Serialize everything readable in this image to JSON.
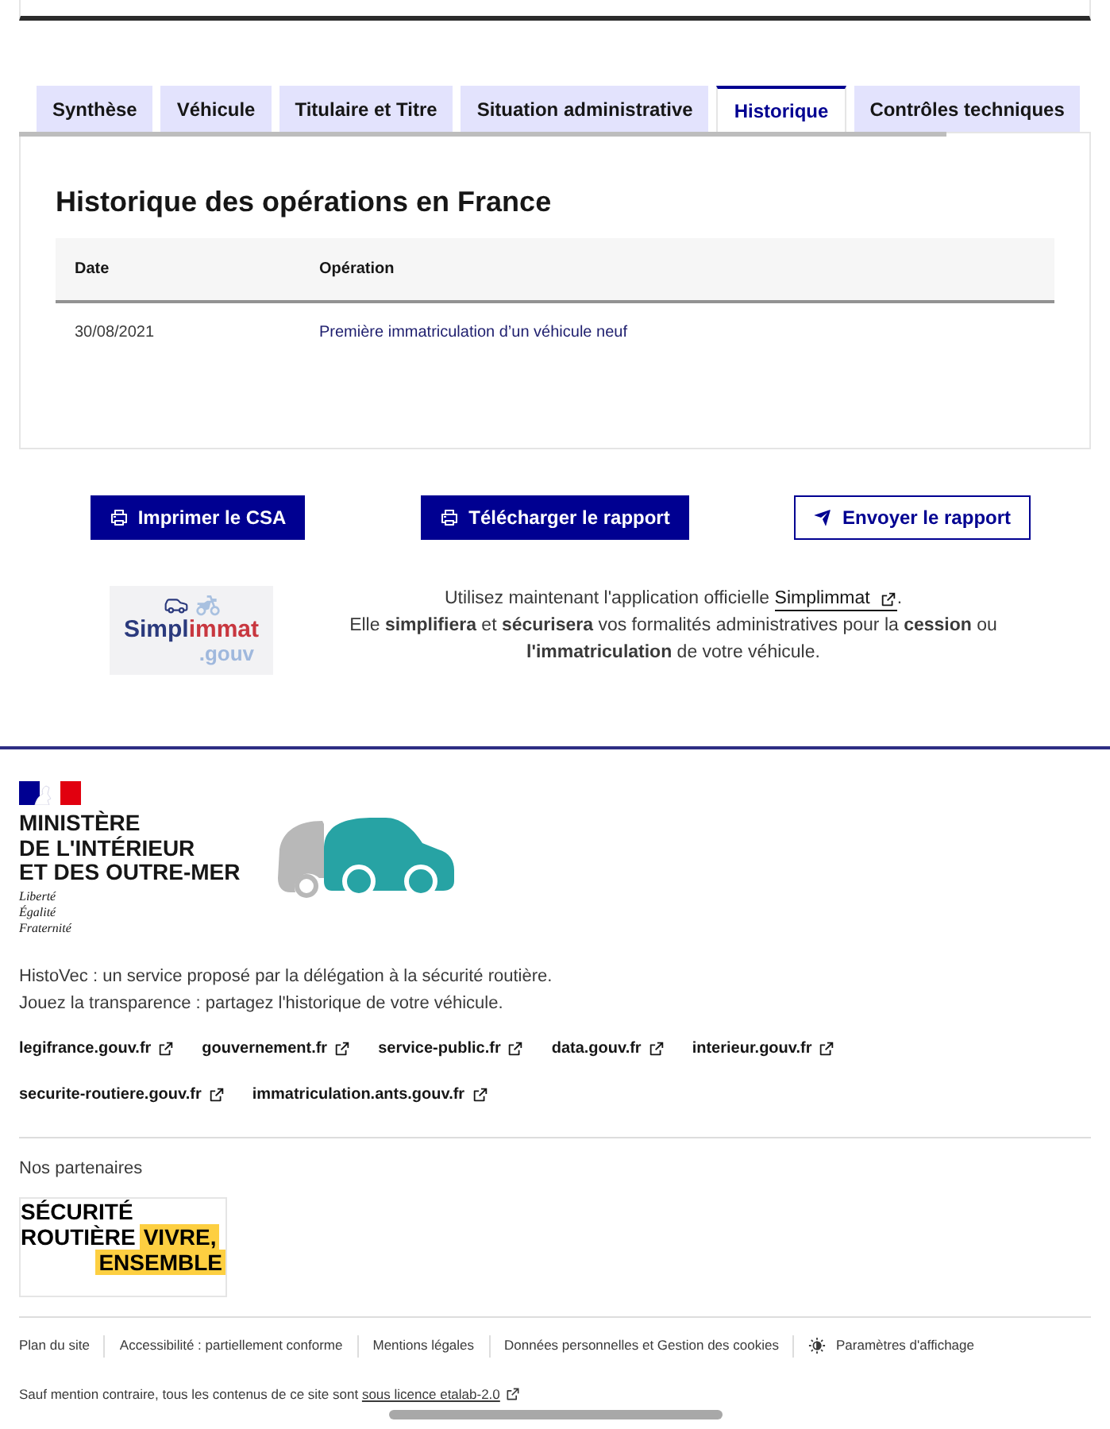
{
  "tabs": [
    {
      "label": "Synthèse",
      "selected": false
    },
    {
      "label": "Véhicule",
      "selected": false
    },
    {
      "label": "Titulaire et Titre",
      "selected": false
    },
    {
      "label": "Situation administrative",
      "selected": false
    },
    {
      "label": "Historique",
      "selected": true
    },
    {
      "label": "Contrôles techniques",
      "selected": false
    }
  ],
  "history": {
    "title": "Historique des opérations en France",
    "table": {
      "columns": [
        "Date",
        "Opération"
      ],
      "rows": [
        [
          "30/08/2021",
          "Première immatriculation d’un véhicule neuf"
        ]
      ]
    }
  },
  "actions": [
    {
      "label": "Imprimer le CSA",
      "kind": "primary"
    },
    {
      "label": "Télécharger le rapport",
      "kind": "primary"
    },
    {
      "label": "Envoyer le rapport",
      "kind": "secondary"
    }
  ],
  "simplimmat": {
    "logo": {
      "wordmark_start": "Simpl",
      "wordmark_end": "immat",
      "domain": ".gouv"
    },
    "intro": "Utilisez maintenant l'application officielle",
    "link": "Simplimmat",
    "after_link": ".",
    "body": "Elle **simplifiera** et **sécurisera** vos formalités administratives pour la **cession** ou **l'immatriculation** de votre véhicule."
  },
  "footer": {
    "ministry": {
      "name_lines": [
        "MINISTÈRE",
        "DE L'INTÉRIEUR",
        "ET DES OUTRE-MER"
      ],
      "motto": [
        "Liberté",
        "Égalité",
        "Fraternité"
      ]
    },
    "description": [
      "HistoVec : un service proposé par la délégation à la sécurité routière.",
      "Jouez la transparence : partagez l'historique de votre véhicule."
    ],
    "link_rows": [
      {
        "links": [
          "legifrance.gouv.fr",
          "gouvernement.fr",
          "service-public.fr",
          "data.gouv.fr",
          "interieur.gouv.fr"
        ]
      },
      {
        "links": [
          "securite-routiere.gouv.fr",
          "immatriculation.ants.gouv.fr"
        ]
      }
    ],
    "partners": {
      "title": "Nos partenaires",
      "logo": {
        "line_1": "SÉCURITÉ",
        "line_2": "ROUTIÈRE",
        "tagline_1": "VIVRE,",
        "tagline_2": "ENSEMBLE"
      }
    },
    "bottom_links": [
      {
        "label": "Plan du site",
        "kind": "link"
      },
      {
        "label": "Accessibilité : partiellement conforme",
        "kind": "link"
      },
      {
        "label": "Mentions légales",
        "kind": "link"
      },
      {
        "label": "Données personnelles et Gestion des cookies",
        "kind": "link"
      },
      {
        "label": "Paramètres d'affichage",
        "kind": "settings"
      }
    ],
    "license": {
      "text": "Sauf mention contraire, tous les contenus de ce site sont",
      "link": "sous licence etalab-2.0"
    }
  }
}
